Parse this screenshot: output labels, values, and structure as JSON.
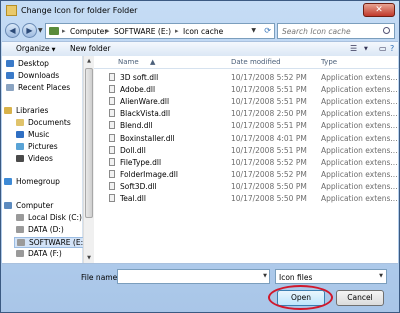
{
  "window": {
    "title": "Change Icon for folder Folder",
    "close_glyph": "✕"
  },
  "address": {
    "back_glyph": "◀",
    "forward_glyph": "▶",
    "crumbs": [
      "Computer",
      "SOFTWARE (E:)",
      "Icon cache"
    ],
    "separator": "▸",
    "search_placeholder": "Search Icon cache"
  },
  "toolbar": {
    "organize_label": "Organize",
    "new_folder_label": "New folder"
  },
  "nav": {
    "items": [
      {
        "label": "Desktop",
        "icon": "desktop-icon",
        "color": "#3a7ac9"
      },
      {
        "label": "Downloads",
        "icon": "downloads-icon",
        "color": "#3a7ac9"
      },
      {
        "label": "Recent Places",
        "icon": "recent-places-icon",
        "color": "#8aa3c1"
      },
      {
        "label": "Libraries",
        "icon": "libraries-icon",
        "color": "#d8b24a"
      },
      {
        "label": "Documents",
        "icon": "documents-icon",
        "color": "#e0c36b"
      },
      {
        "label": "Music",
        "icon": "music-icon",
        "color": "#2f6fc3"
      },
      {
        "label": "Pictures",
        "icon": "pictures-icon",
        "color": "#59a3d6"
      },
      {
        "label": "Videos",
        "icon": "videos-icon",
        "color": "#4a4a4a"
      },
      {
        "label": "Homegroup",
        "icon": "homegroup-icon",
        "color": "#3d8ad6"
      },
      {
        "label": "Computer",
        "icon": "computer-icon",
        "color": "#5d8bbf"
      },
      {
        "label": "Local Disk (C:)",
        "icon": "drive-icon",
        "color": "#9a9a9a"
      },
      {
        "label": "DATA (D:)",
        "icon": "drive-icon",
        "color": "#9a9a9a"
      },
      {
        "label": "SOFTWARE (E:)",
        "icon": "drive-icon",
        "color": "#9a9a9a"
      },
      {
        "label": "DATA (F:)",
        "icon": "drive-icon",
        "color": "#9a9a9a"
      }
    ]
  },
  "list": {
    "columns": [
      "Name",
      "Date modified",
      "Type"
    ],
    "rows": [
      {
        "name": "3D soft.dll",
        "date": "10/17/2008 5:52 PM",
        "type": "Application extens..."
      },
      {
        "name": "Adobe.dll",
        "date": "10/17/2008 5:51 PM",
        "type": "Application extens..."
      },
      {
        "name": "AlienWare.dll",
        "date": "10/17/2008 5:51 PM",
        "type": "Application extens..."
      },
      {
        "name": "BlackVista.dll",
        "date": "10/17/2008 2:50 PM",
        "type": "Application extens..."
      },
      {
        "name": "Blend.dll",
        "date": "10/17/2008 5:51 PM",
        "type": "Application extens..."
      },
      {
        "name": "Boxinstaller.dll",
        "date": "10/17/2008 4:01 PM",
        "type": "Application extens..."
      },
      {
        "name": "Doll.dll",
        "date": "10/17/2008 5:51 PM",
        "type": "Application extens..."
      },
      {
        "name": "FileType.dll",
        "date": "10/17/2008 5:52 PM",
        "type": "Application extens..."
      },
      {
        "name": "FolderImage.dll",
        "date": "10/17/2008 5:52 PM",
        "type": "Application extens..."
      },
      {
        "name": "Soft3D.dll",
        "date": "10/17/2008 5:50 PM",
        "type": "Application extens..."
      },
      {
        "name": "Teal.dll",
        "date": "10/17/2008 5:50 PM",
        "type": "Application extens..."
      }
    ]
  },
  "footer": {
    "file_name_label": "File name:",
    "file_name_value": "",
    "file_type_value": "Icon files",
    "open_label": "Open",
    "cancel_label": "Cancel",
    "highlight_color": "#d0182c"
  }
}
